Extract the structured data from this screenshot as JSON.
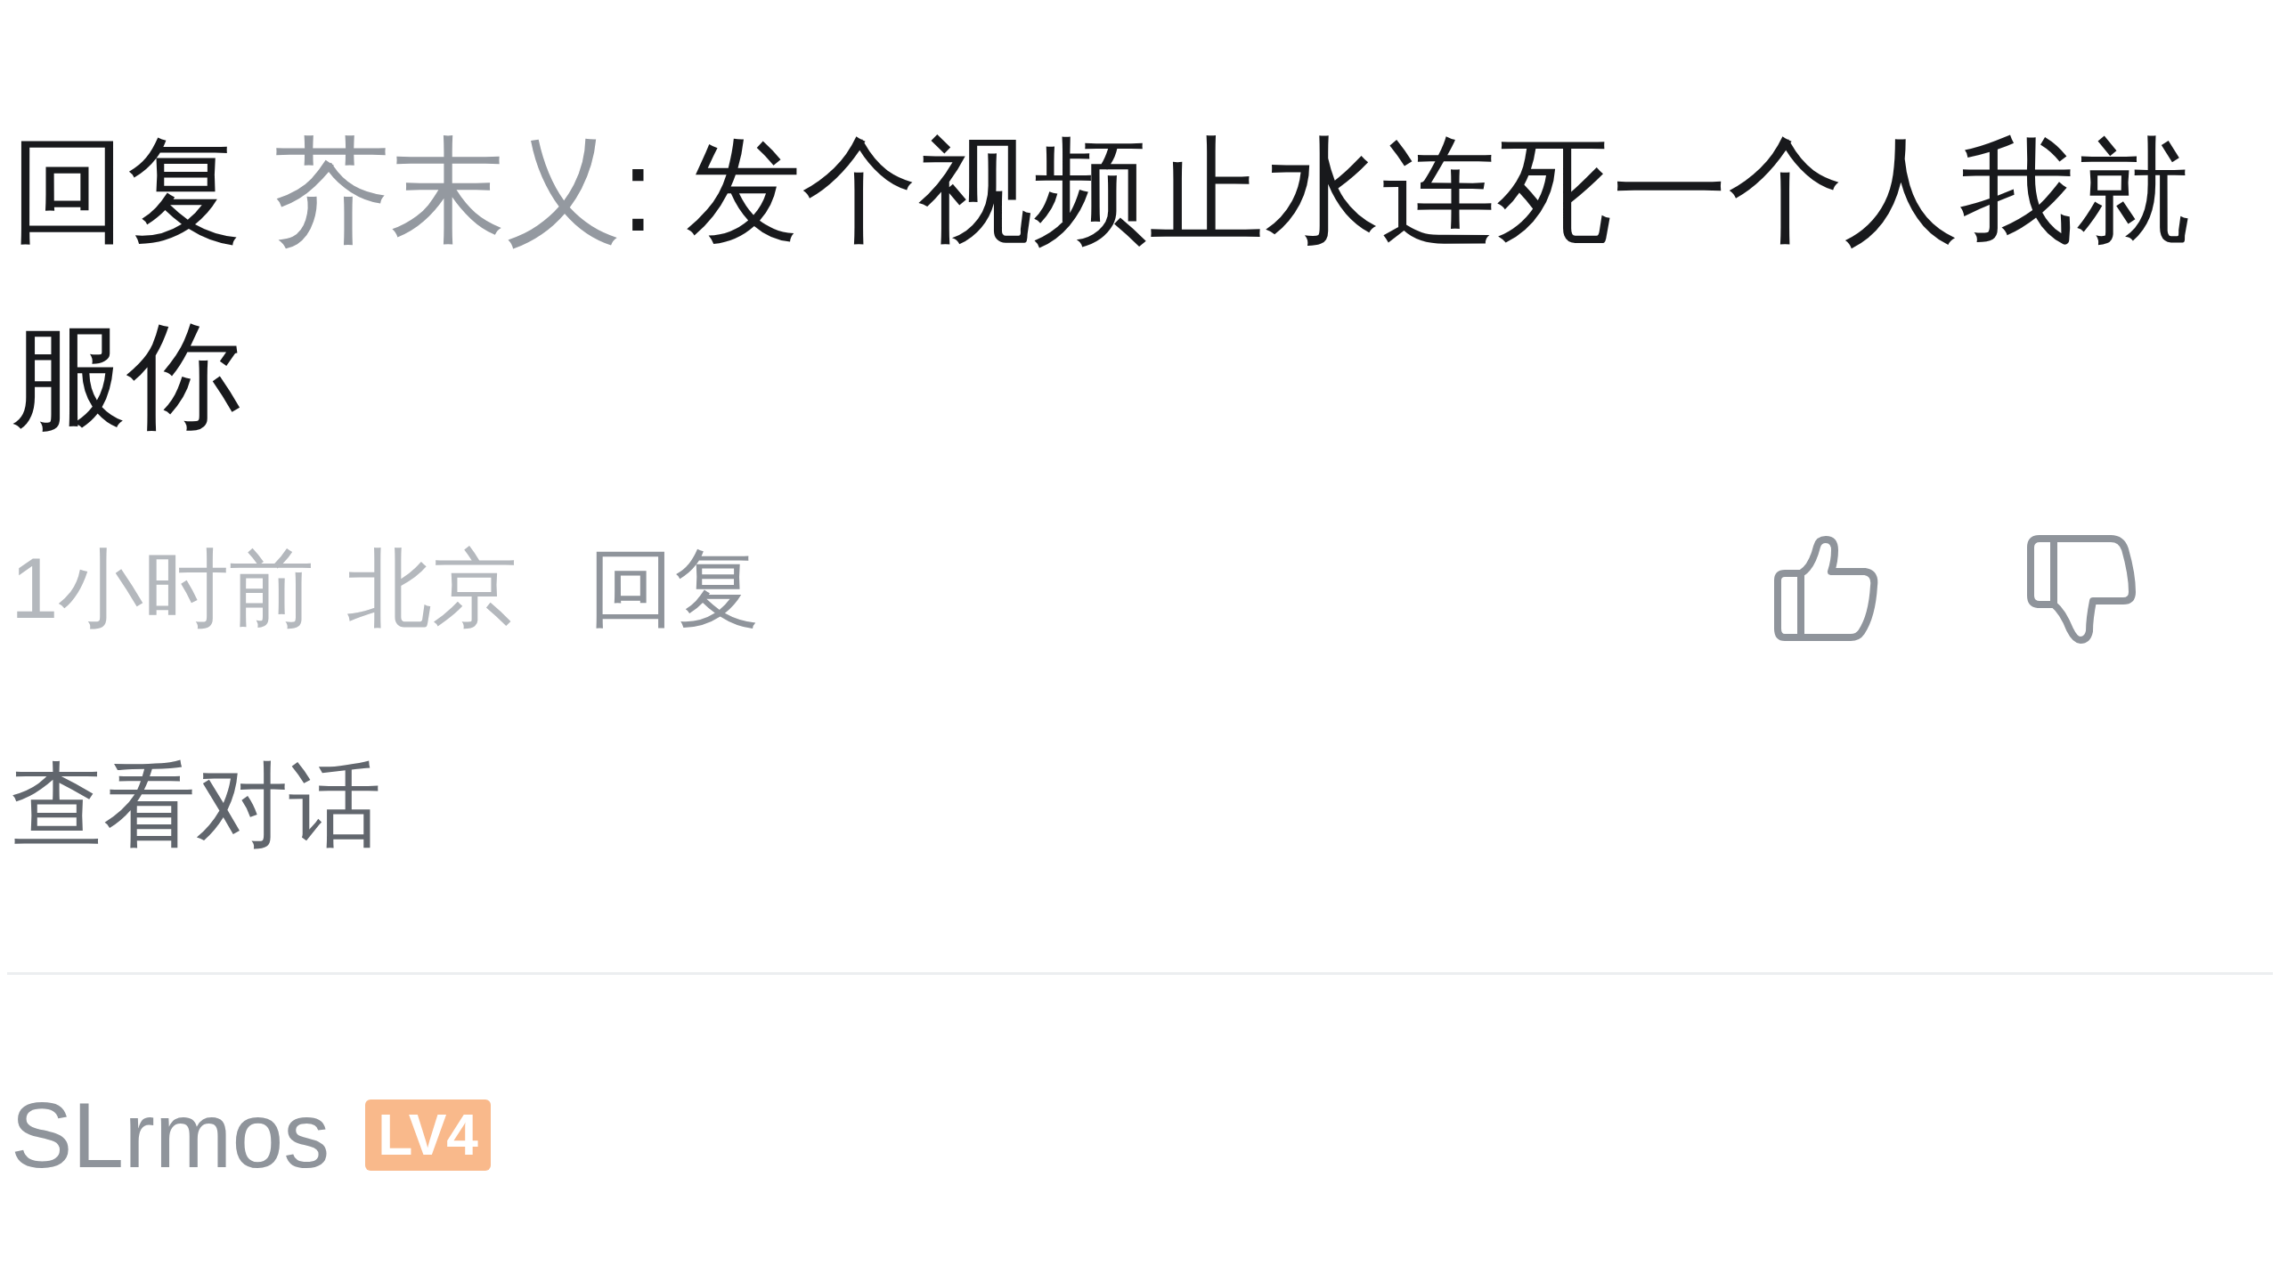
{
  "comment": {
    "reply_label": "回复",
    "reply_to": "芥末乂",
    "separator": ":",
    "text": "发个视频止水连死一个人我就服你",
    "time": "1小时前",
    "location": "北京",
    "reply_button": "回复",
    "liked": false,
    "disliked": false,
    "view_conversation": "查看对话"
  },
  "next_comment": {
    "username": "SLrmos",
    "level": "LV4"
  }
}
